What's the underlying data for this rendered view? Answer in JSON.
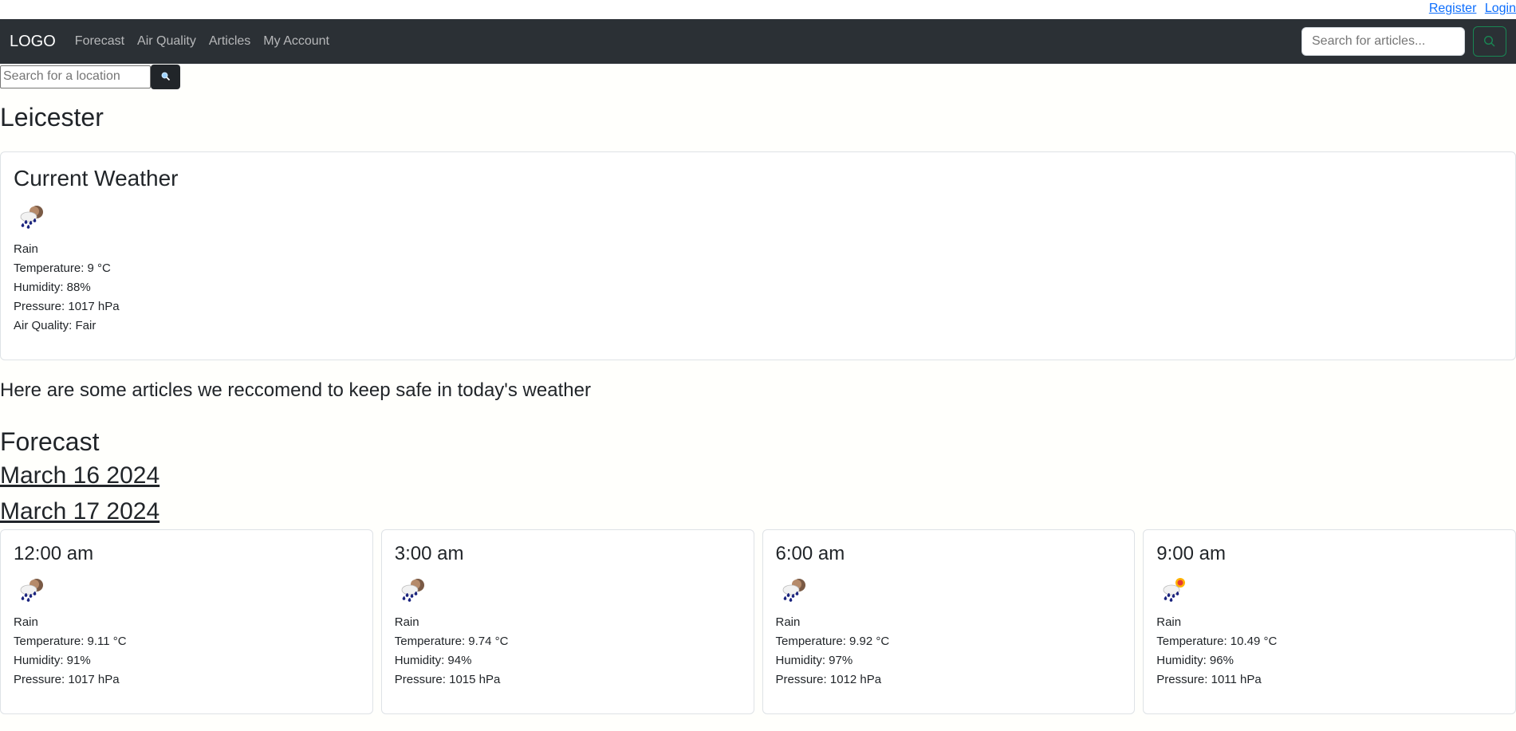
{
  "auth": {
    "register": "Register",
    "login": "Login"
  },
  "navbar": {
    "logo": "LOGO",
    "links": [
      "Forecast",
      "Air Quality",
      "Articles",
      "My Account"
    ],
    "search_placeholder": "Search for articles..."
  },
  "location_search": {
    "placeholder": "Search for a location",
    "button_icon": "search-icon"
  },
  "city": "Leicester",
  "current": {
    "title": "Current Weather",
    "icon": "rain-cloud-icon",
    "condition": "Rain",
    "temperature": "Temperature: 9 °C",
    "humidity": "Humidity: 88%",
    "pressure": "Pressure: 1017 hPa",
    "air_quality": "Air Quality: Fair"
  },
  "recommendation": "Here are some articles we reccomend to keep safe in today's weather",
  "forecast": {
    "title": "Forecast",
    "dates": [
      "March 16 2024",
      "March 17 2024"
    ],
    "cards": [
      {
        "time": "12:00 am",
        "icon": "rain-cloud-icon",
        "condition": "Rain",
        "temperature": "Temperature: 9.11 °C",
        "humidity": "Humidity: 91%",
        "pressure": "Pressure: 1017 hPa"
      },
      {
        "time": "3:00 am",
        "icon": "rain-cloud-icon",
        "condition": "Rain",
        "temperature": "Temperature: 9.74 °C",
        "humidity": "Humidity: 94%",
        "pressure": "Pressure: 1015 hPa"
      },
      {
        "time": "6:00 am",
        "icon": "rain-cloud-icon",
        "condition": "Rain",
        "temperature": "Temperature: 9.92 °C",
        "humidity": "Humidity: 97%",
        "pressure": "Pressure: 1012 hPa"
      },
      {
        "time": "9:00 am",
        "icon": "rain-sun-icon",
        "condition": "Rain",
        "temperature": "Temperature: 10.49 °C",
        "humidity": "Humidity: 96%",
        "pressure": "Pressure: 1011 hPa"
      }
    ]
  }
}
